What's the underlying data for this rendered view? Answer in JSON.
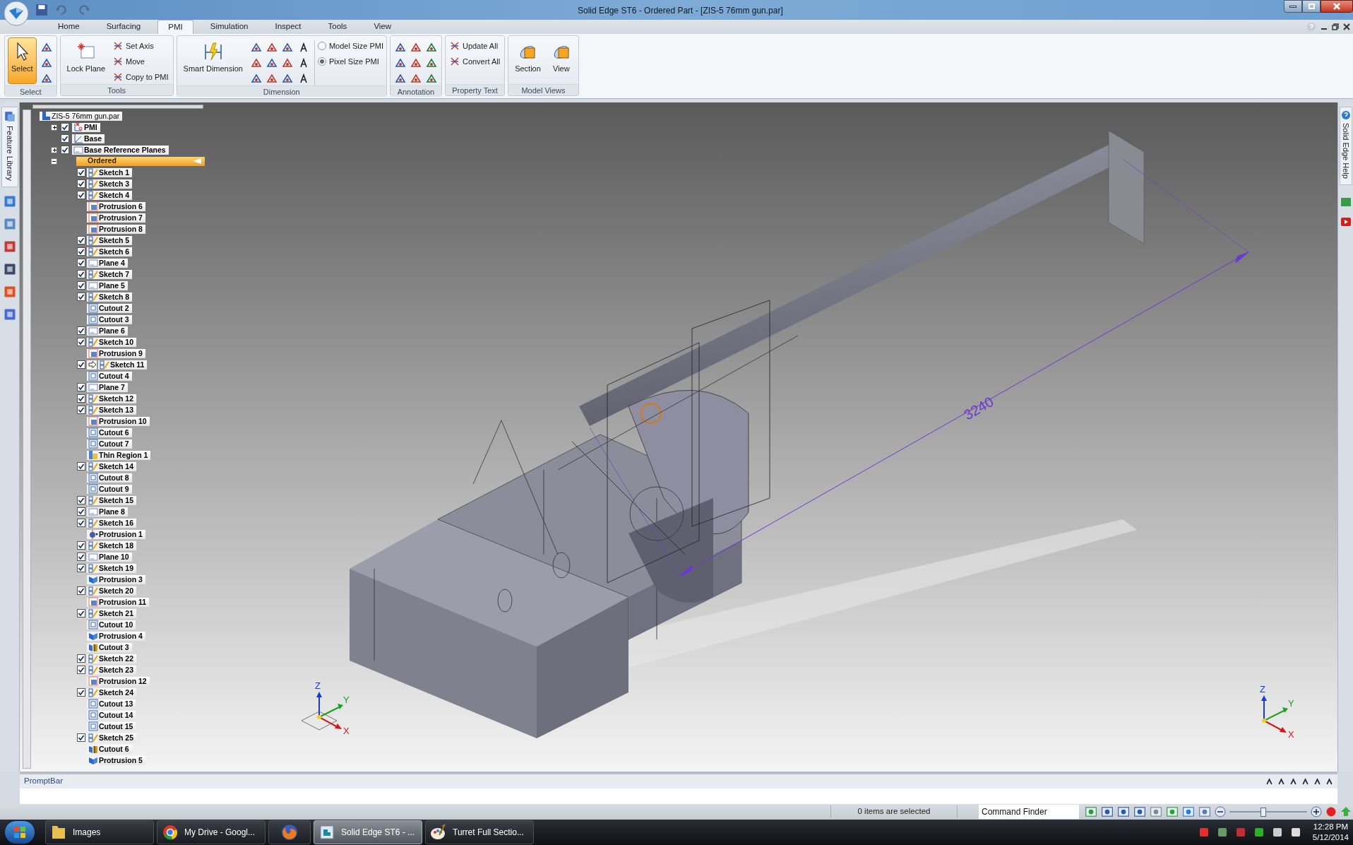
{
  "window": {
    "title": "Solid Edge ST6 - Ordered Part - [ZIS-5 76mm gun.par]"
  },
  "ribbon": {
    "tabs": [
      {
        "label": "Home",
        "selected": false
      },
      {
        "label": "Surfacing",
        "selected": false
      },
      {
        "label": "PMI",
        "selected": true
      },
      {
        "label": "Simulation",
        "selected": false
      },
      {
        "label": "Inspect",
        "selected": false
      },
      {
        "label": "Tools",
        "selected": false
      },
      {
        "label": "View",
        "selected": false
      }
    ],
    "groups": [
      {
        "kind": "select",
        "label": "Select",
        "large": [
          {
            "label": "Select",
            "selected": true
          }
        ]
      },
      {
        "kind": "tools",
        "label": "Tools",
        "large": [
          {
            "label": "Lock Plane",
            "selected": false
          }
        ],
        "small": [
          "Set Axis",
          "Move",
          "Copy to PMI"
        ]
      },
      {
        "kind": "dimension",
        "label": "Dimension",
        "large": [
          {
            "label": "Smart Dimension",
            "selected": false
          }
        ],
        "radios": [
          {
            "label": "Model Size PMI",
            "selected": false
          },
          {
            "label": "Pixel Size PMI",
            "selected": true
          }
        ]
      },
      {
        "kind": "annotation",
        "label": "Annotation"
      },
      {
        "kind": "property",
        "label": "Property Text",
        "small": [
          "Update All",
          "Convert All"
        ]
      },
      {
        "kind": "views",
        "label": "Model Views",
        "large": [
          {
            "label": "Section",
            "selected": false
          },
          {
            "label": "View",
            "selected": false
          }
        ]
      }
    ]
  },
  "side_tabs": {
    "left": "Feature Library",
    "right": "Solid Edge Help"
  },
  "tree": {
    "label": "ZIS-5 76mm gun.par",
    "kind": "root",
    "selected": false,
    "children": [
      {
        "label": "PMI",
        "kind": "pmi",
        "expanded": false,
        "checked": true,
        "selected": false
      },
      {
        "label": "Base",
        "kind": "base",
        "checked": true,
        "selected": false
      },
      {
        "label": "Base Reference Planes",
        "kind": "planes",
        "expanded": false,
        "checked": true,
        "selected": false
      },
      {
        "label": "Ordered",
        "kind": "ordered",
        "expanded": true,
        "selected": true,
        "children": [
          {
            "label": "Sketch 1",
            "kind": "sketch",
            "checked": true,
            "selected": false
          },
          {
            "label": "Sketch 3",
            "kind": "sketch",
            "checked": true,
            "selected": false
          },
          {
            "label": "Sketch 4",
            "kind": "sketch",
            "checked": true,
            "selected": false
          },
          {
            "label": "Protrusion 6",
            "kind": "protrusion",
            "selected": false
          },
          {
            "label": "Protrusion 7",
            "kind": "protrusion",
            "selected": false
          },
          {
            "label": "Protrusion 8",
            "kind": "protrusion",
            "selected": false
          },
          {
            "label": "Sketch 5",
            "kind": "sketch",
            "checked": true,
            "selected": false
          },
          {
            "label": "Sketch 6",
            "kind": "sketch",
            "checked": true,
            "selected": false
          },
          {
            "label": "Plane 4",
            "kind": "plane",
            "checked": true,
            "selected": false
          },
          {
            "label": "Sketch 7",
            "kind": "sketch",
            "checked": true,
            "selected": false
          },
          {
            "label": "Plane 5",
            "kind": "plane",
            "checked": true,
            "selected": false
          },
          {
            "label": "Sketch 8",
            "kind": "sketch",
            "checked": true,
            "selected": false
          },
          {
            "label": "Cutout 2",
            "kind": "cutout",
            "selected": false
          },
          {
            "label": "Cutout 3",
            "kind": "cutout",
            "selected": false
          },
          {
            "label": "Plane 6",
            "kind": "plane",
            "checked": true,
            "selected": false
          },
          {
            "label": "Sketch 10",
            "kind": "sketch",
            "checked": true,
            "selected": false
          },
          {
            "label": "Protrusion 9",
            "kind": "protrusion",
            "selected": false
          },
          {
            "label": "Sketch 11",
            "kind": "markedsketch",
            "checked": true,
            "selected": false
          },
          {
            "label": "Cutout 4",
            "kind": "cutout",
            "selected": false
          },
          {
            "label": "Plane 7",
            "kind": "plane",
            "checked": true,
            "selected": false
          },
          {
            "label": "Sketch 12",
            "kind": "sketch",
            "checked": true,
            "selected": false
          },
          {
            "label": "Sketch 13",
            "kind": "sketch",
            "checked": true,
            "selected": false
          },
          {
            "label": "Protrusion 10",
            "kind": "protrusion",
            "selected": false
          },
          {
            "label": "Cutout 6",
            "kind": "cutout",
            "selected": false
          },
          {
            "label": "Cutout 7",
            "kind": "cutout",
            "selected": false
          },
          {
            "label": "Thin Region 1",
            "kind": "thinregion",
            "selected": false
          },
          {
            "label": "Sketch 14",
            "kind": "sketch",
            "checked": true,
            "selected": false
          },
          {
            "label": "Cutout 8",
            "kind": "cutout",
            "selected": false
          },
          {
            "label": "Cutout 9",
            "kind": "cutout",
            "selected": false
          },
          {
            "label": "Sketch 15",
            "kind": "sketch",
            "checked": true,
            "selected": false
          },
          {
            "label": "Plane 8",
            "kind": "plane",
            "checked": true,
            "selected": false
          },
          {
            "label": "Sketch 16",
            "kind": "sketch",
            "checked": true,
            "selected": false
          },
          {
            "label": "Protrusion 1",
            "kind": "revolve",
            "selected": false
          },
          {
            "label": "Sketch 18",
            "kind": "sketch",
            "checked": true,
            "selected": false
          },
          {
            "label": "Plane 10",
            "kind": "plane",
            "checked": true,
            "selected": false
          },
          {
            "label": "Sketch 19",
            "kind": "sketch",
            "checked": true,
            "selected": false
          },
          {
            "label": "Protrusion 3",
            "kind": "extrude",
            "selected": false
          },
          {
            "label": "Sketch 20",
            "kind": "sketch",
            "checked": true,
            "selected": false
          },
          {
            "label": "Protrusion 11",
            "kind": "protrusion",
            "selected": false
          },
          {
            "label": "Sketch 21",
            "kind": "sketch",
            "checked": true,
            "selected": false
          },
          {
            "label": "Cutout 10",
            "kind": "cutout",
            "selected": false
          },
          {
            "label": "Protrusion 4",
            "kind": "extrude",
            "selected": false
          },
          {
            "label": "Cutout 3",
            "kind": "cut",
            "selected": false
          },
          {
            "label": "Sketch 22",
            "kind": "sketch",
            "checked": true,
            "selected": false
          },
          {
            "label": "Sketch 23",
            "kind": "sketch",
            "checked": true,
            "selected": false
          },
          {
            "label": "Protrusion 12",
            "kind": "protrusion",
            "selected": false
          },
          {
            "label": "Sketch 24",
            "kind": "sketch",
            "checked": true,
            "selected": false
          },
          {
            "label": "Cutout 13",
            "kind": "cutout",
            "selected": false
          },
          {
            "label": "Cutout 14",
            "kind": "cutout",
            "selected": false
          },
          {
            "label": "Cutout 15",
            "kind": "cutout",
            "selected": false
          },
          {
            "label": "Sketch 25",
            "kind": "sketch",
            "checked": true,
            "selected": false
          },
          {
            "label": "Cutout 6",
            "kind": "cut",
            "selected": false
          },
          {
            "label": "Protrusion 5",
            "kind": "extrude",
            "selected": false
          }
        ]
      }
    ]
  },
  "viewport": {
    "dimension": "3240",
    "triads": [
      {
        "labels": [
          "Z",
          "Y",
          "X"
        ]
      },
      {
        "labels": [
          "Z",
          "Y",
          "X"
        ]
      }
    ]
  },
  "prompt_bar": {
    "title": "PromptBar"
  },
  "status_bar": {
    "selection": "0 items are selected",
    "command_finder": {
      "placeholder": "Command Finder"
    },
    "zoom": {
      "level": 0.44
    }
  },
  "taskbar": {
    "items": [
      {
        "kind": "folder",
        "label": "Images",
        "selected": false
      },
      {
        "kind": "chrome",
        "label": "My Drive - Googl...",
        "selected": false
      },
      {
        "kind": "firefox",
        "selected": false
      },
      {
        "kind": "solidedge",
        "label": "Solid Edge ST6 - ...",
        "selected": true
      },
      {
        "kind": "paint",
        "label": "Turret Full Sectio...",
        "selected": false
      }
    ],
    "time": "12:28 PM",
    "date": "5/12/2014"
  }
}
